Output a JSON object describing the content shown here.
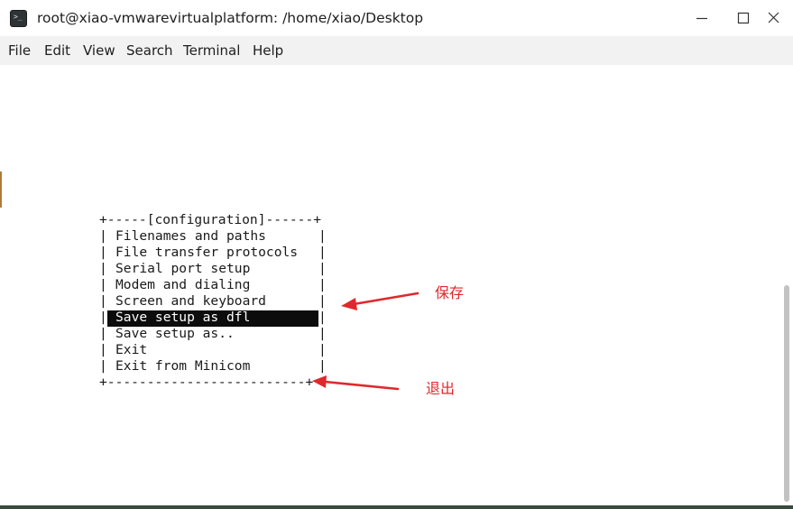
{
  "window": {
    "title": "root@xiao-vmwarevirtualplatform: /home/xiao/Desktop",
    "app_icon_text": ">_",
    "controls": [
      "minimize-icon",
      "maximize-icon",
      "close-icon"
    ]
  },
  "menubar": {
    "items": [
      "File",
      "Edit",
      "View",
      "Search",
      "Terminal",
      "Help"
    ]
  },
  "minicom_menu": {
    "top_border": "+-----[configuration]------+",
    "bottom_border": "+-------------------------+",
    "side": "|",
    "entries": [
      "Filenames and paths",
      "File transfer protocols",
      "Serial port setup",
      "Modem and dialing",
      "Screen and keyboard",
      "Save setup as dfl",
      "Save setup as..",
      "Exit",
      "Exit from Minicom"
    ],
    "selected_entry": "Save setup as dfl"
  },
  "annotations": {
    "save_label": "保存",
    "exit_label": "退出",
    "color": "#e0282c"
  },
  "colors": {
    "menubar_bg": "#f2f2f2",
    "highlight_bg": "#0c0c0c",
    "terminal_text": "#1a1a1a"
  }
}
